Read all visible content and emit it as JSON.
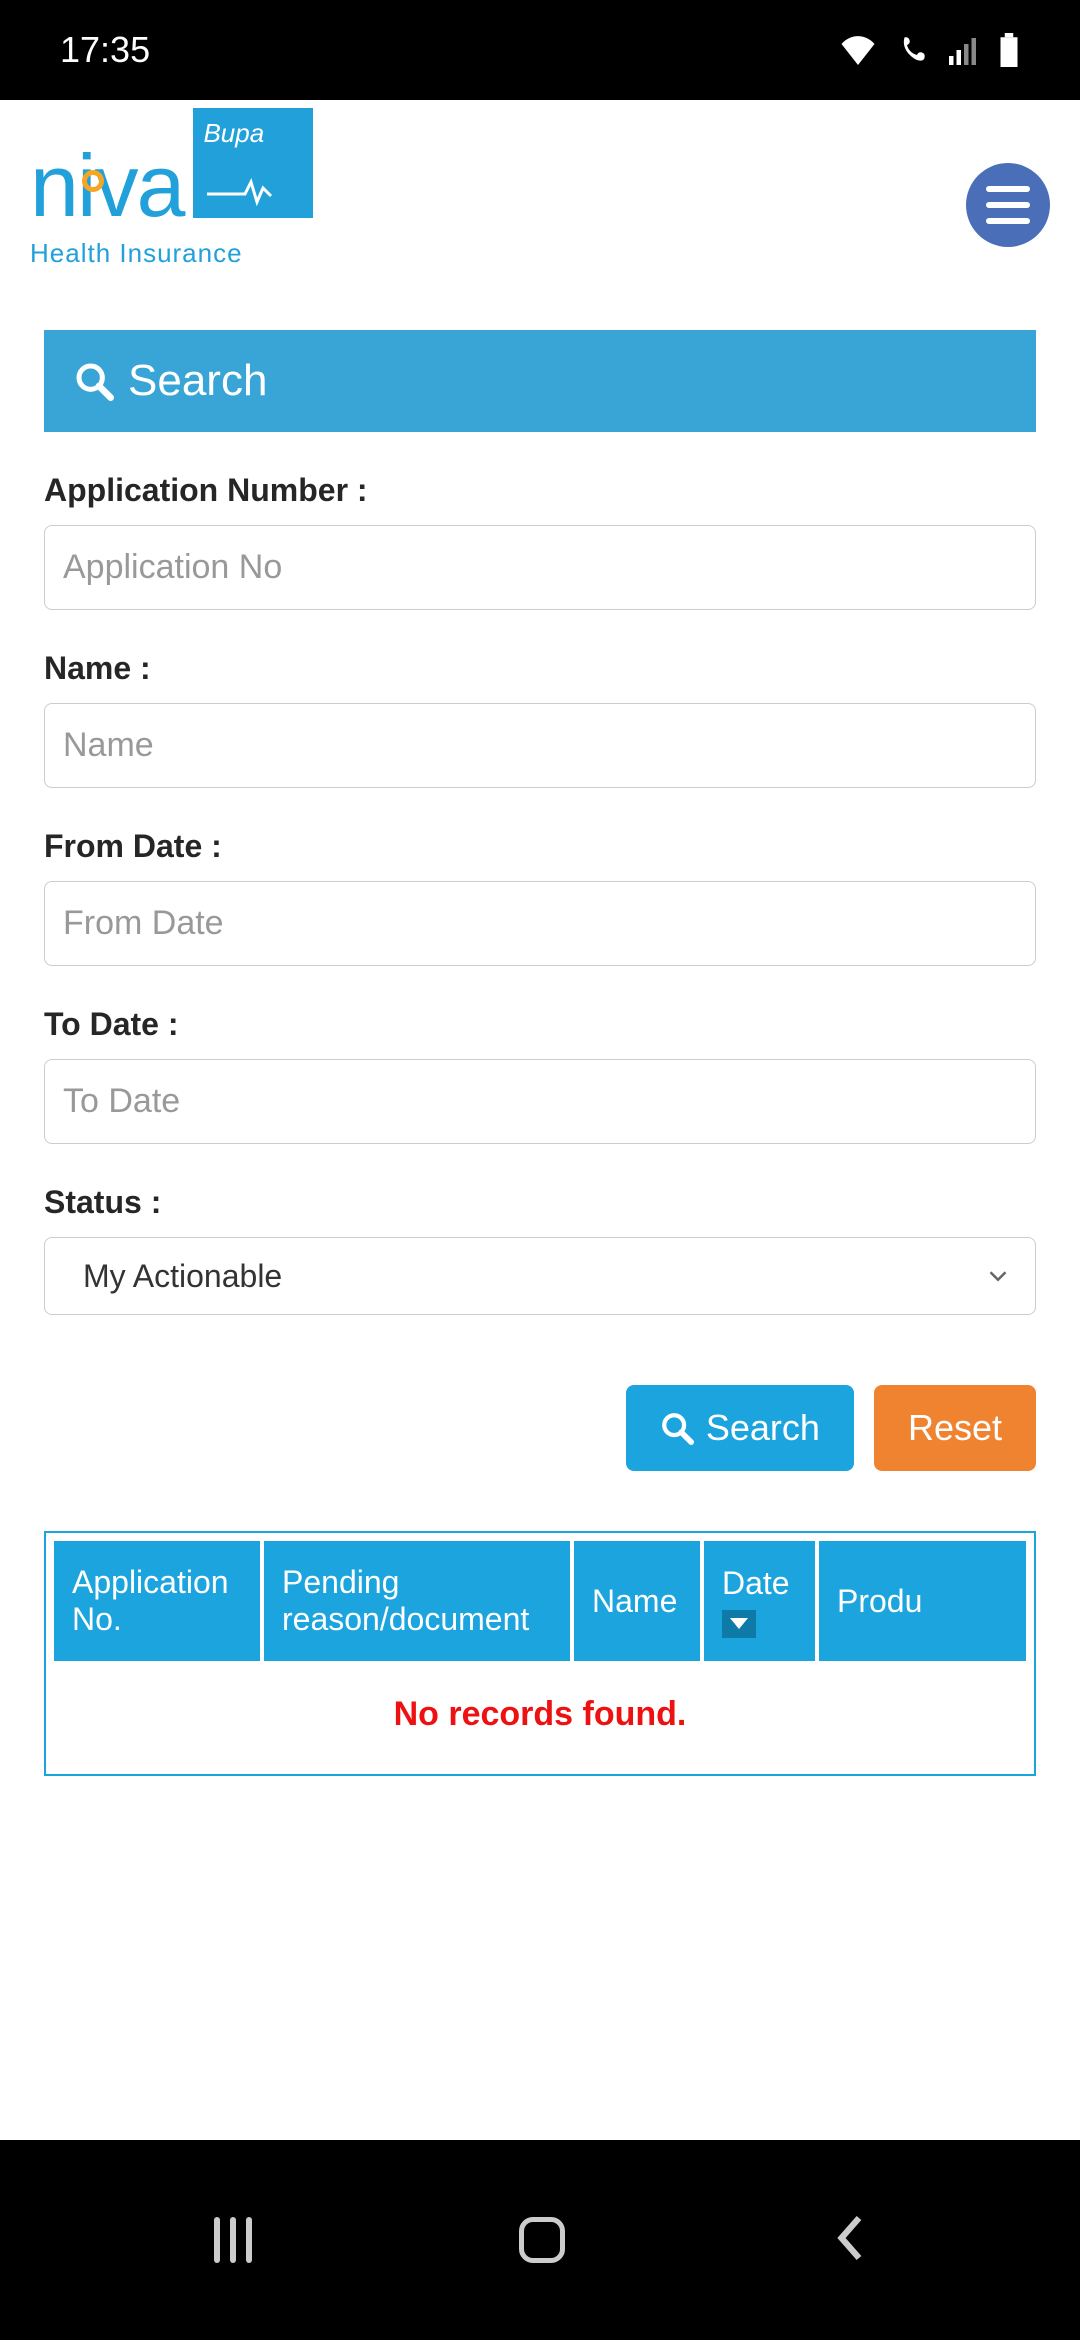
{
  "status_bar": {
    "time": "17:35"
  },
  "brand": {
    "name": "niva",
    "partner": "Bupa",
    "tagline": "Health Insurance"
  },
  "search_panel": {
    "title": "Search"
  },
  "form": {
    "application_number": {
      "label": "Application Number :",
      "placeholder": "Application No",
      "value": ""
    },
    "name": {
      "label": "Name :",
      "placeholder": "Name",
      "value": ""
    },
    "from_date": {
      "label": "From Date :",
      "placeholder": "From Date",
      "value": ""
    },
    "to_date": {
      "label": "To Date :",
      "placeholder": "To Date",
      "value": ""
    },
    "status": {
      "label": "Status :",
      "selected": "My Actionable"
    }
  },
  "buttons": {
    "search": "Search",
    "reset": "Reset"
  },
  "table": {
    "columns": [
      "Application No.",
      "Pending reason/document",
      "Name",
      "Date",
      "Produ"
    ],
    "empty_message": "No records found."
  }
}
